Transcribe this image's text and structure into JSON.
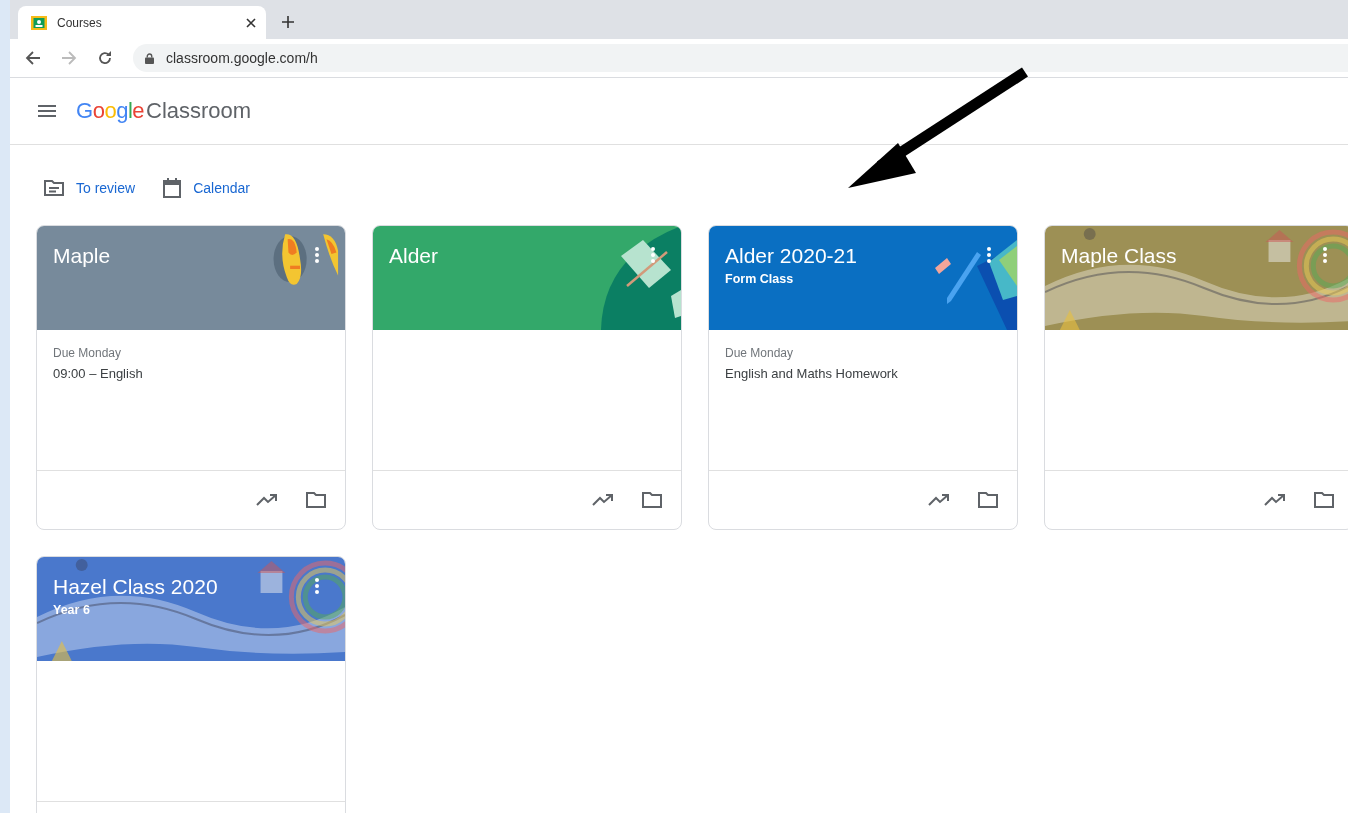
{
  "browser": {
    "tab": {
      "title": "Courses",
      "selected": true
    },
    "url": "classroom.google.com/h"
  },
  "header": {
    "logo": "Google",
    "app_name": "Classroom"
  },
  "toolbar": [
    {
      "kind": "review",
      "label": "To review"
    },
    {
      "kind": "calendar",
      "label": "Calendar"
    }
  ],
  "courses": [
    {
      "title": "Maple",
      "banner": {
        "kind": "shoes",
        "color": "#778a9b"
      },
      "due_label": "Due Monday",
      "assignment": "09:00 – English"
    },
    {
      "title": "Alder",
      "banner": {
        "kind": "book",
        "color": "#33a86a"
      }
    },
    {
      "title": "Alder 2020-21",
      "subtitle": "Form Class",
      "banner": {
        "kind": "pencil",
        "color": "#0a6fc2"
      },
      "due_label": "Due Monday",
      "assignment": "English and Maths Homework"
    },
    {
      "title": "Maple Class"
    },
    {
      "title": "Hazel Class 2020",
      "subtitle": "Year 6"
    }
  ]
}
